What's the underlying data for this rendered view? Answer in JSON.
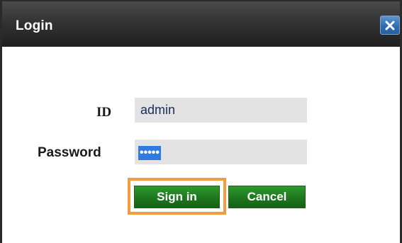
{
  "dialog": {
    "title": "Login",
    "close_icon": "close-icon"
  },
  "form": {
    "id_label": "ID",
    "id_value": "admin",
    "password_label": "Password",
    "password_value": "•••••"
  },
  "buttons": {
    "sign_in_label": "Sign in",
    "cancel_label": "Cancel"
  },
  "colors": {
    "titlebar": "#333333",
    "close_button": "#2f6db4",
    "button_green": "#1f7a1f",
    "highlight_orange": "#f39c3e",
    "field_background": "#e3e3e3",
    "selection_blue": "#2f7be0"
  }
}
